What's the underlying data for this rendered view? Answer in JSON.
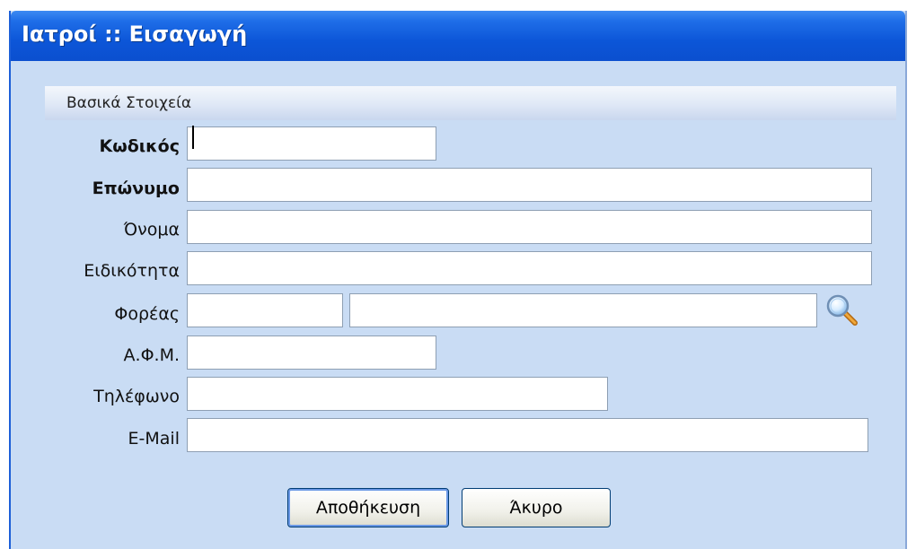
{
  "window": {
    "title": "Ιατροί :: Εισαγωγή"
  },
  "group": {
    "label": "Βασικά Στοιχεία"
  },
  "fields": {
    "code": {
      "label": "Κωδικός",
      "value": ""
    },
    "surname": {
      "label": "Επώνυμο",
      "value": ""
    },
    "name": {
      "label": "Όνομα",
      "value": ""
    },
    "specialty": {
      "label": "Ειδικότητα",
      "value": ""
    },
    "provider": {
      "label": "Φορέας",
      "code_value": "",
      "name_value": ""
    },
    "afm": {
      "label": "Α.Φ.Μ.",
      "value": ""
    },
    "phone": {
      "label": "Τηλέφωνο",
      "value": ""
    },
    "email": {
      "label": "E-Mail",
      "value": ""
    }
  },
  "buttons": {
    "save": "Αποθήκευση",
    "cancel": "Άκυρο"
  },
  "icons": {
    "provider_lookup": "search-icon"
  },
  "colors": {
    "titlebar": "#0c56d8",
    "background": "#c9dcf4",
    "title_text": "#ffffff"
  }
}
